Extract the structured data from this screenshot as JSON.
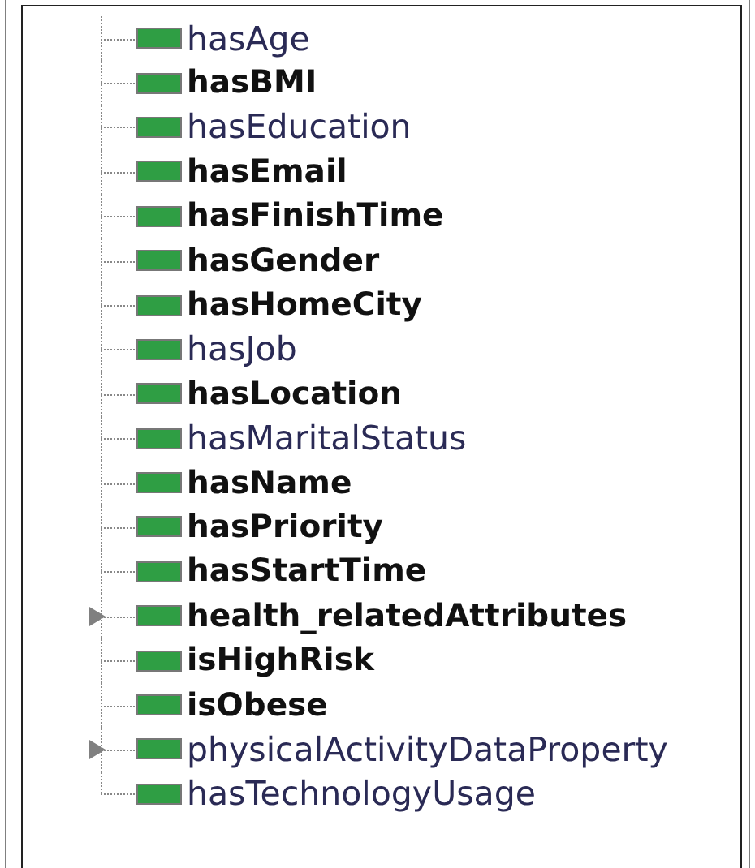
{
  "tree": {
    "items": [
      {
        "label": "hasAge",
        "bold": false,
        "expandable": false
      },
      {
        "label": "hasBMI",
        "bold": true,
        "expandable": false
      },
      {
        "label": "hasEducation",
        "bold": false,
        "expandable": false
      },
      {
        "label": "hasEmail",
        "bold": true,
        "expandable": false
      },
      {
        "label": "hasFinishTime",
        "bold": true,
        "expandable": false
      },
      {
        "label": "hasGender",
        "bold": true,
        "expandable": false
      },
      {
        "label": "hasHomeCity",
        "bold": true,
        "expandable": false
      },
      {
        "label": "hasJob",
        "bold": false,
        "expandable": false
      },
      {
        "label": "hasLocation",
        "bold": true,
        "expandable": false
      },
      {
        "label": "hasMaritalStatus",
        "bold": false,
        "expandable": false
      },
      {
        "label": "hasName",
        "bold": true,
        "expandable": false
      },
      {
        "label": "hasPriority",
        "bold": true,
        "expandable": false
      },
      {
        "label": "hasStartTime",
        "bold": true,
        "expandable": false
      },
      {
        "label": "health_relatedAttributes",
        "bold": true,
        "expandable": true
      },
      {
        "label": "isHighRisk",
        "bold": true,
        "expandable": false
      },
      {
        "label": "isObese",
        "bold": true,
        "expandable": false
      },
      {
        "label": "physicalActivityDataProperty",
        "bold": false,
        "expandable": true
      },
      {
        "label": "hasTechnologyUsage",
        "bold": false,
        "expandable": false
      }
    ]
  }
}
